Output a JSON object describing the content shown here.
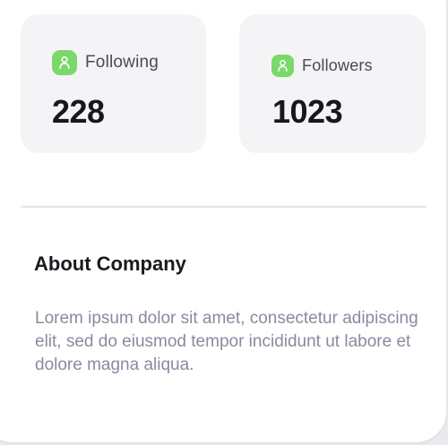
{
  "stats": {
    "following": {
      "label": "Following",
      "value": "228"
    },
    "followers": {
      "label": "Followers",
      "value": "1023"
    }
  },
  "about": {
    "title": "About Company",
    "body": "Lorem ipsum dolor sit amet, consectetur adipiscing elit, sed do eiusmod tempor incididunt ut labore et dolore magna aliqua."
  },
  "colors": {
    "accent_green": "#7bd86a",
    "card_background": "#f4f4f6",
    "body_text": "#8a8aa0"
  },
  "icons": {
    "stat_icon": "user-icon"
  }
}
